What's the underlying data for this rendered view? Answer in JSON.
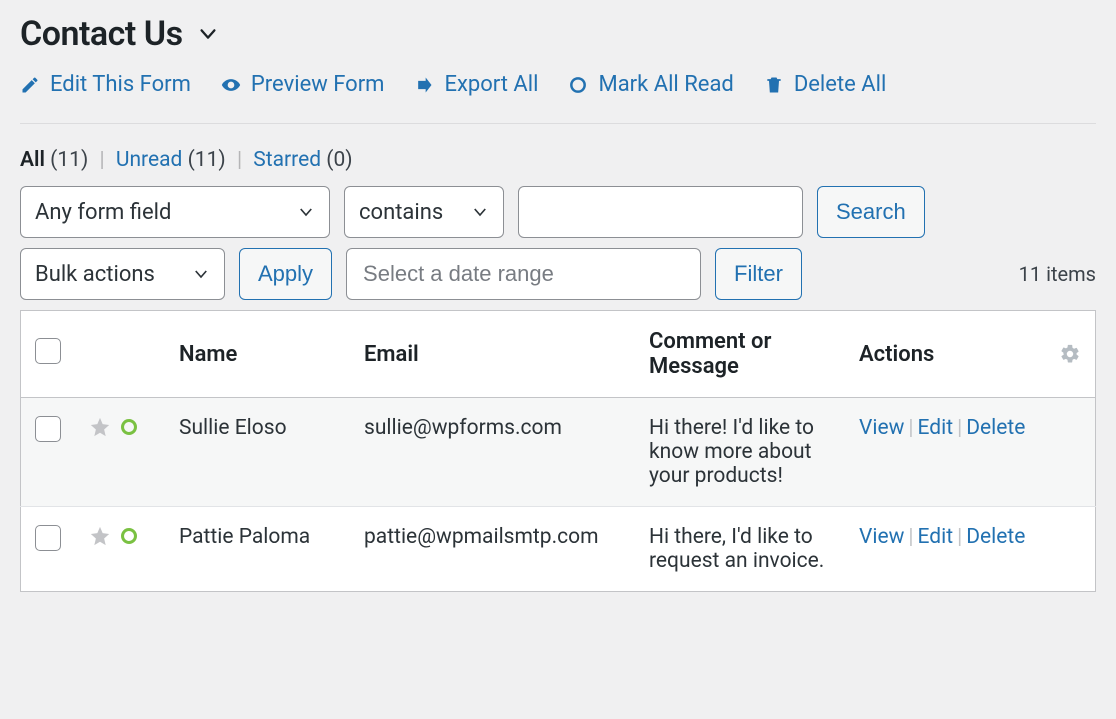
{
  "header": {
    "title": "Contact Us",
    "links": {
      "edit": "Edit This Form",
      "preview": "Preview Form",
      "export": "Export All",
      "markread": "Mark All Read",
      "deleteall": "Delete All"
    }
  },
  "tabs": {
    "all": {
      "label": "All",
      "count": "(11)"
    },
    "unread": {
      "label": "Unread",
      "count": "(11)"
    },
    "starred": {
      "label": "Starred",
      "count": "(0)"
    }
  },
  "filters": {
    "field_select": "Any form field",
    "operator_select": "contains",
    "search_value": "",
    "search_btn": "Search",
    "bulk_select": "Bulk actions",
    "apply_btn": "Apply",
    "date_placeholder": "Select a date range",
    "filter_btn": "Filter",
    "items_count": "11 items"
  },
  "table": {
    "columns": {
      "name": "Name",
      "email": "Email",
      "message": "Comment or Message",
      "actions": "Actions"
    },
    "action_labels": {
      "view": "View",
      "edit": "Edit",
      "delete": "Delete"
    },
    "rows": [
      {
        "name": "Sullie Eloso",
        "email": "sullie@wpforms.com",
        "message": "Hi there! I'd like to know more about your products!"
      },
      {
        "name": "Pattie Paloma",
        "email": "pattie@wpmailsmtp.com",
        "message": "Hi there, I'd like to request an invoice."
      }
    ]
  }
}
